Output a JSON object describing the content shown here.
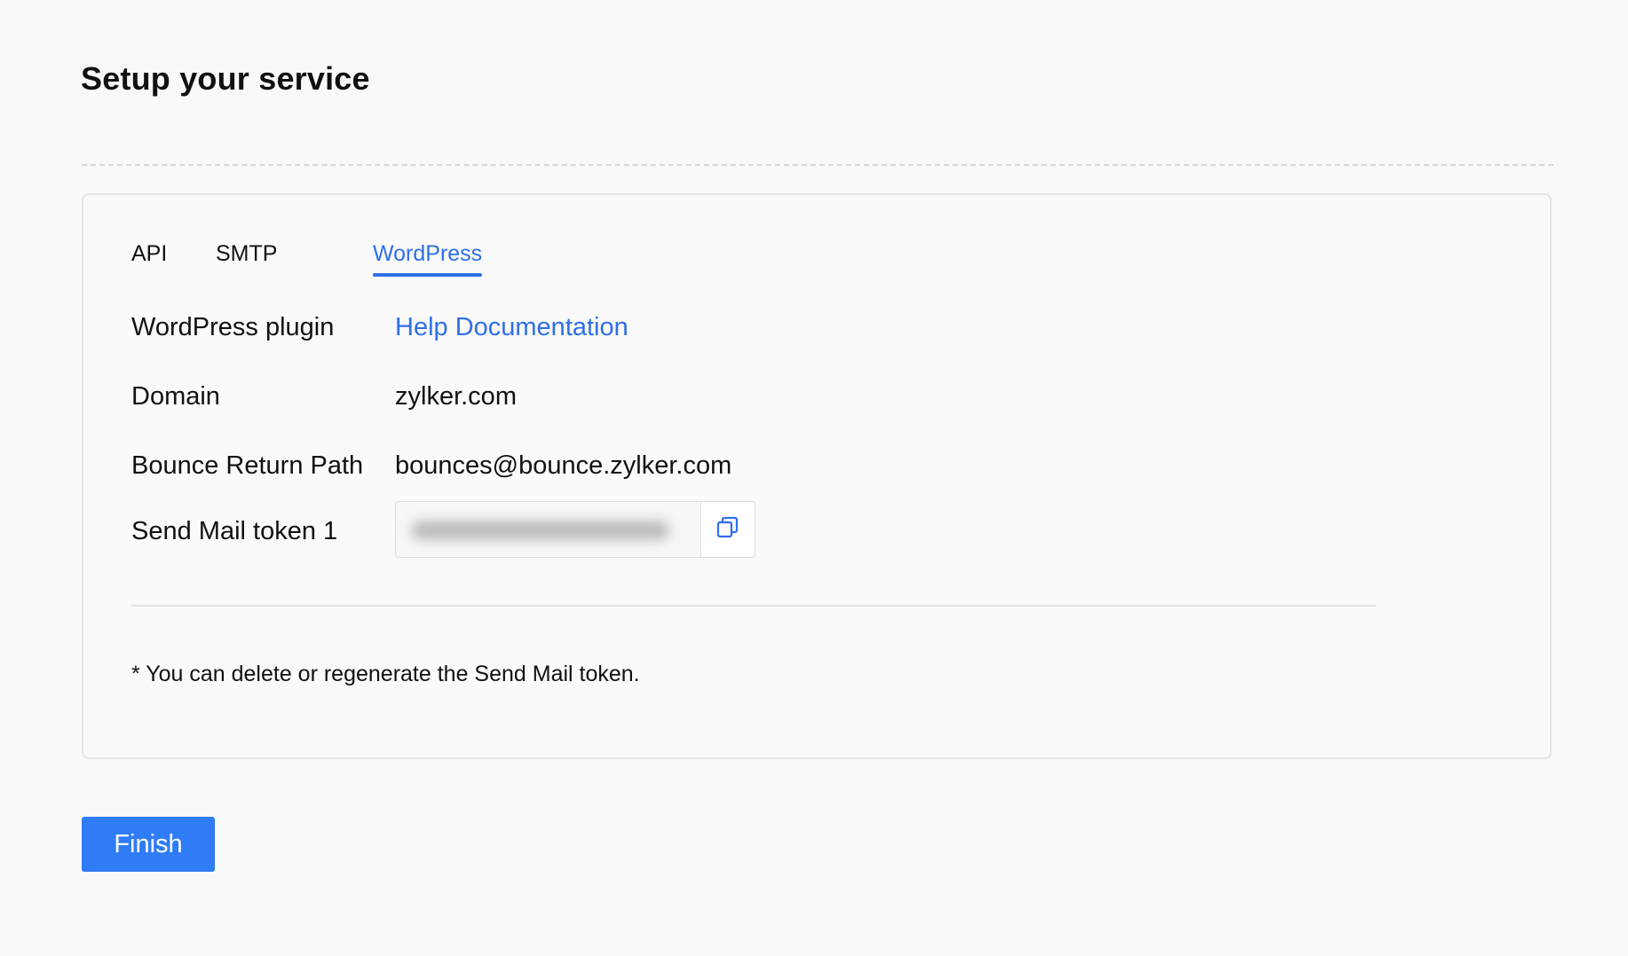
{
  "page": {
    "title": "Setup your service"
  },
  "tabs": [
    {
      "label": "API",
      "active": false
    },
    {
      "label": "SMTP",
      "active": false
    },
    {
      "label": "WordPress",
      "active": true
    }
  ],
  "details": {
    "plugin_label": "WordPress plugin",
    "plugin_link": "Help Documentation",
    "domain_label": "Domain",
    "domain_value": "zylker.com",
    "bounce_label": "Bounce Return Path",
    "bounce_value": "bounces@bounce.zylker.com",
    "token_label": "Send Mail token 1",
    "token_value_hidden": true,
    "copy_icon": "copy-icon"
  },
  "note": "* You can delete or regenerate the Send Mail token.",
  "actions": {
    "finish_label": "Finish"
  },
  "colors": {
    "accent": "#2f6ee8",
    "button": "#2f7cf6",
    "background": "#f9f9f9"
  }
}
